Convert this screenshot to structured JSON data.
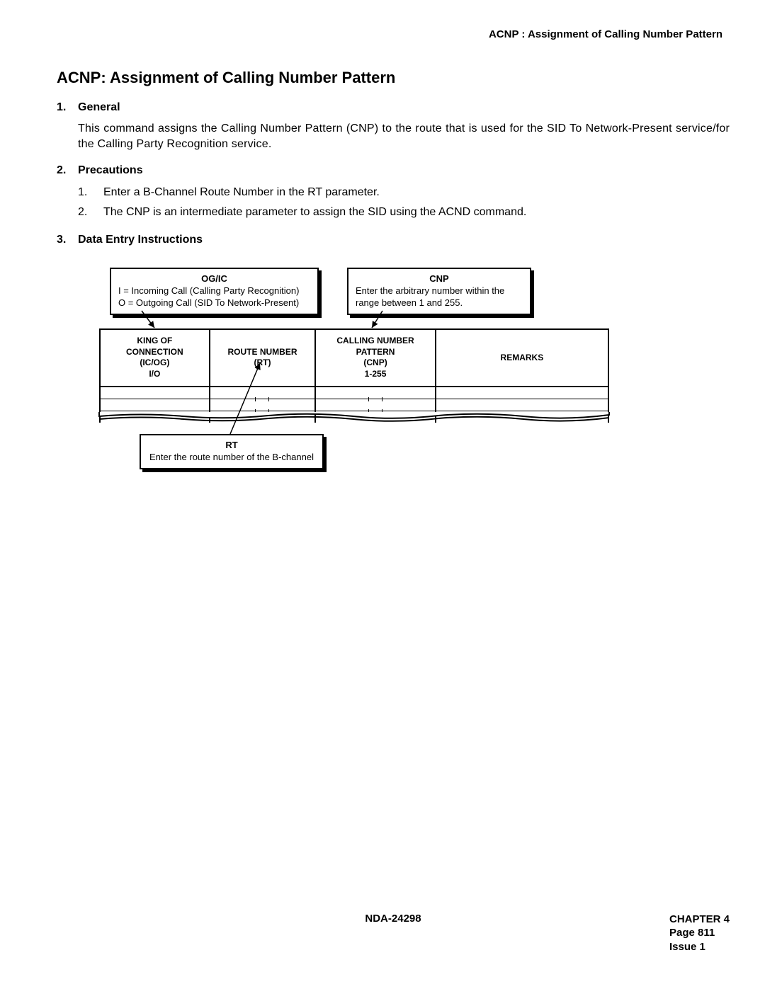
{
  "header": "ACNP : Assignment of Calling Number Pattern",
  "title": "ACNP: Assignment of Calling Number Pattern",
  "sections": {
    "general": {
      "num": "1.",
      "label": "General",
      "text": "This command assigns the Calling Number Pattern (CNP) to the route that is used for the SID To Network-Present service/for the Calling Party Recognition service."
    },
    "precautions": {
      "num": "2.",
      "label": "Precautions",
      "items": [
        {
          "n": "1.",
          "t": "Enter a B-Channel Route Number in the RT parameter."
        },
        {
          "n": "2.",
          "t": "The CNP is an intermediate parameter to assign the SID using the ACND command."
        }
      ]
    },
    "data_entry": {
      "num": "3.",
      "label": "Data Entry Instructions"
    }
  },
  "callouts": {
    "ogic": {
      "title": "OG/IC",
      "line1": "I = Incoming Call (Calling Party Recognition)",
      "line2": "O = Outgoing Call (SID To Network-Present)"
    },
    "cnp": {
      "title": "CNP",
      "body": "Enter the arbitrary number within the range between 1 and 255."
    },
    "rt": {
      "title": "RT",
      "body": "Enter the route number of the B-channel"
    }
  },
  "table": {
    "headers": {
      "king": "KING OF\nCONNECTION\n(IC/OG)\nI/O",
      "route": "ROUTE NUMBER\n(RT)",
      "cnp": "CALLING NUMBER\nPATTERN\n(CNP)\n1-255",
      "remarks": "REMARKS"
    }
  },
  "footer": {
    "docnum": "NDA-24298",
    "chapter": "CHAPTER 4",
    "page": "Page 811",
    "issue": "Issue 1"
  }
}
